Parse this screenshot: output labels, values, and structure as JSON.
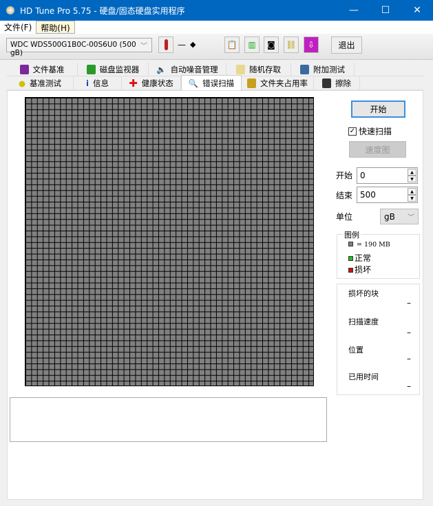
{
  "window": {
    "title": "HD Tune Pro 5.75 - 硬盘/固态硬盘实用程序",
    "minimize": "—",
    "maximize": "☐",
    "close": "✕"
  },
  "menu": [
    {
      "label": "文件(F)"
    },
    {
      "label": "帮助(H)"
    }
  ],
  "toolbar": {
    "drive": "WDC WDS500G1B0C-00S6U0 (500 gB)",
    "temperature": "—",
    "exit": "退出"
  },
  "tabs_top": [
    {
      "label": "文件基准",
      "color": "#7a2a9a"
    },
    {
      "label": "磁盘监视器",
      "color": "#2a9a2a"
    },
    {
      "label": "自动噪音管理",
      "color": "#333"
    },
    {
      "label": "随机存取",
      "color": "#d8c070"
    },
    {
      "label": "附加测试",
      "color": "#3a6aa0"
    }
  ],
  "tabs_bottom": [
    {
      "label": "基准测试",
      "color": "#e0d000"
    },
    {
      "label": "信息",
      "color": "#1040c0"
    },
    {
      "label": "健康状态",
      "color": "#e01010"
    },
    {
      "label": "错误扫描",
      "color": "#208040"
    },
    {
      "label": "文件夹占用率",
      "color": "#c8a020"
    },
    {
      "label": "擦除",
      "color": "#333"
    }
  ],
  "scan": {
    "start_button": "开始",
    "quick_scan_label": "快速扫描",
    "quick_scan_checked": true,
    "speed_map_button": "速度图",
    "start_label": "开始",
    "start_value": "0",
    "end_label": "结束",
    "end_value": "500",
    "unit_label": "单位",
    "unit_value": "gB",
    "legend": {
      "title": "图例",
      "block": "= 190 MB",
      "ok": "正常",
      "bad": "损坏",
      "colors": {
        "block": "#808080",
        "ok": "#20c020",
        "bad": "#d01010"
      }
    },
    "stats": [
      {
        "label": "损坏的块",
        "value": "–"
      },
      {
        "label": "扫描速度",
        "value": "–"
      },
      {
        "label": "位置",
        "value": "–"
      },
      {
        "label": "已用时间",
        "value": "–"
      }
    ]
  }
}
